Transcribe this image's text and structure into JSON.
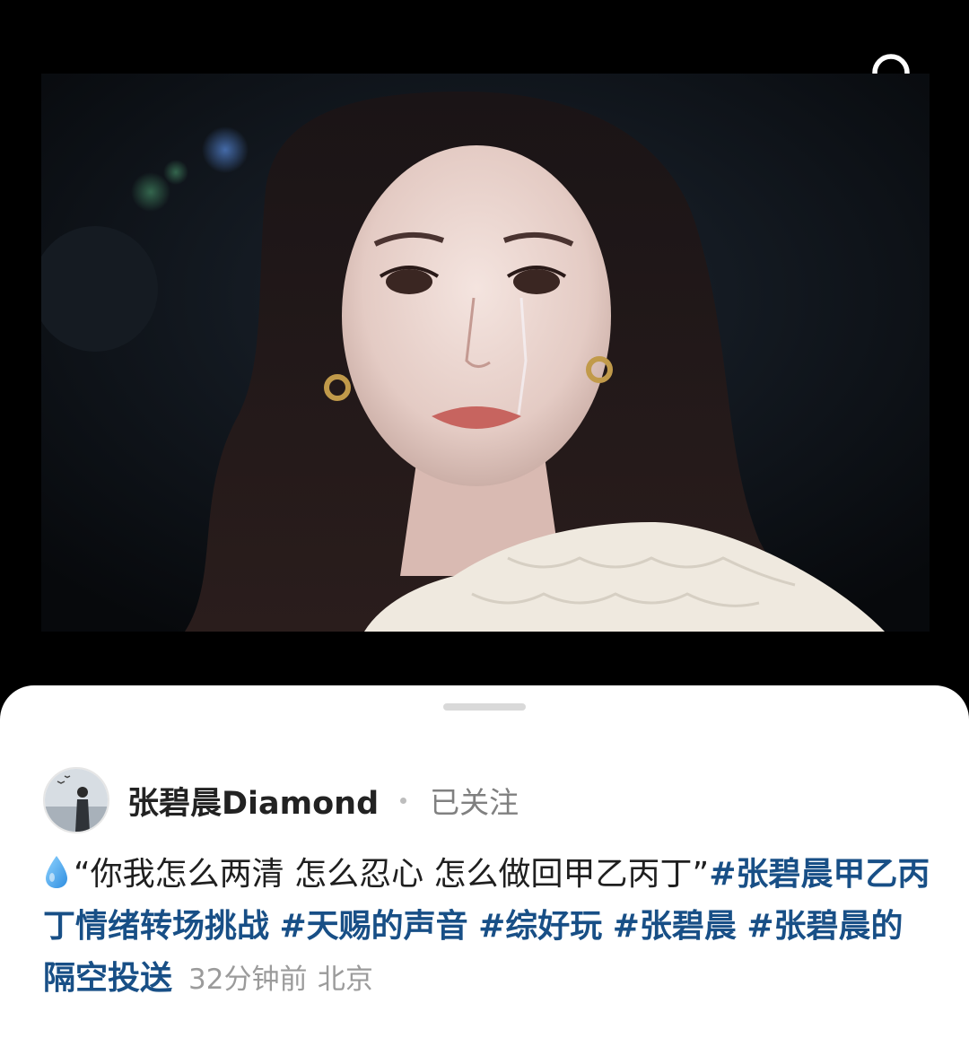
{
  "search": {
    "icon": "search-icon"
  },
  "video": {
    "icon": "video-thumbnail-image"
  },
  "post": {
    "author": {
      "name": "张碧晨Diamond",
      "follow_status": "已关注"
    },
    "emoji": "water-drop-icon",
    "quote": "“你我怎么两清 怎么忍心 怎么做回甲乙丙丁”",
    "hashtags": [
      "#张碧晨甲乙丙丁情绪转场挑战",
      "#天赐的声音",
      "#综好玩",
      "#张碧晨",
      "#张碧晨的隔空投送"
    ],
    "time": "32分钟前",
    "location": "北京"
  },
  "colors": {
    "hashtag": "#184f86",
    "text": "#1f1f1f",
    "meta": "#9b9b9b",
    "background": "#000000",
    "sheet": "#ffffff"
  }
}
